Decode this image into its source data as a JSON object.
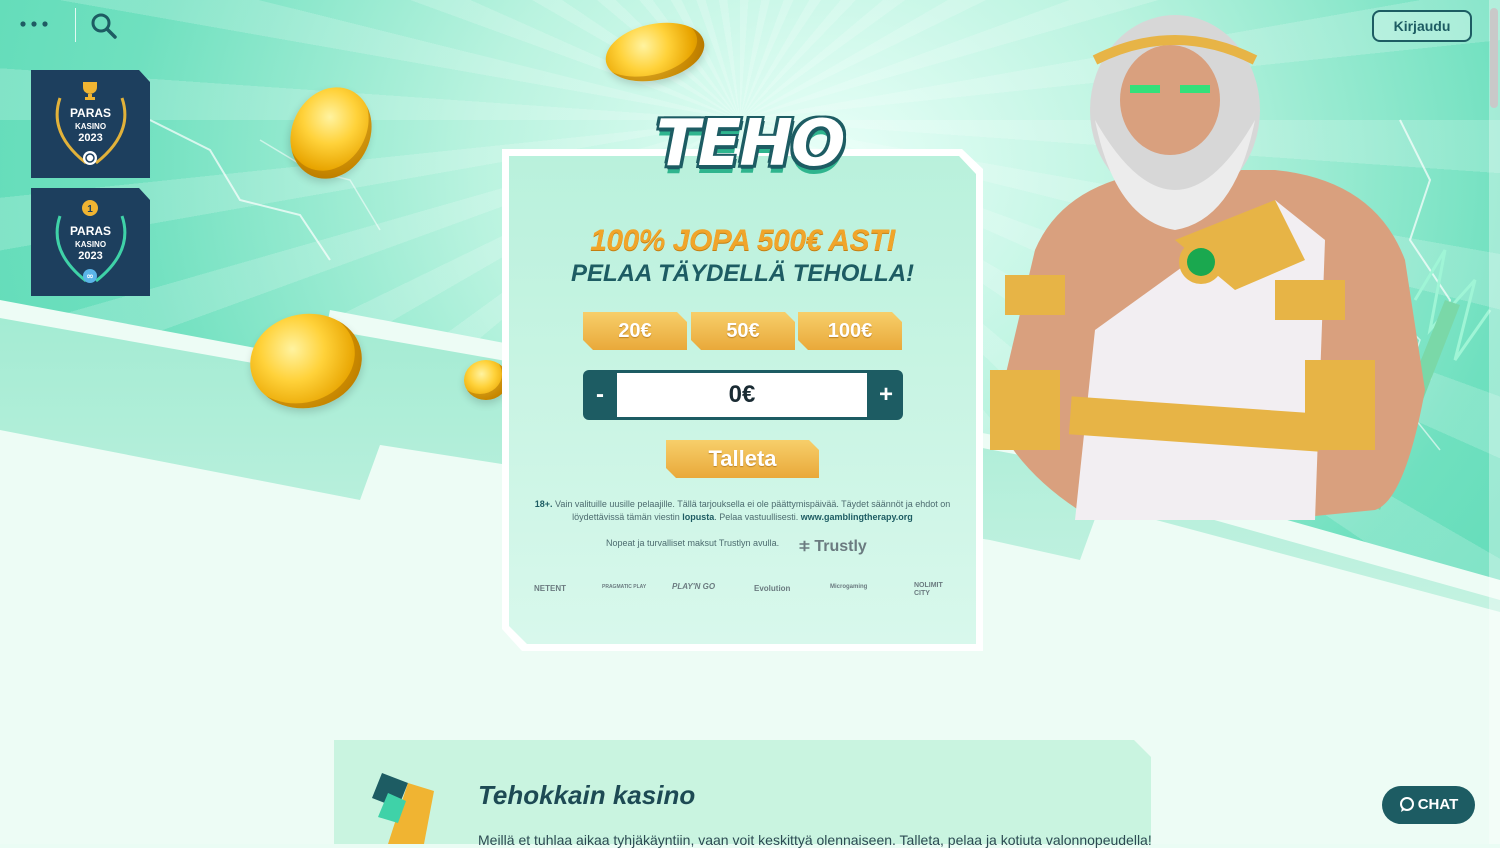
{
  "topbar": {
    "menu_icon": "more-dots-icon",
    "search_icon": "search-icon",
    "login_label": "Kirjaudu"
  },
  "badges": [
    {
      "line1": "PARAS",
      "line2": "KASINO",
      "line3": "2023",
      "icon": "trophy-icon"
    },
    {
      "line1": "PARAS",
      "line2": "KASINO",
      "line3": "2023",
      "icon": "medal-icon"
    }
  ],
  "logo": {
    "text": "TEHO"
  },
  "offer": {
    "headline": "100% JOPA 500€ ASTI",
    "subline": "PELAA TÄYDELLÄ TEHOLLA!",
    "amounts": [
      "20€",
      "50€",
      "100€"
    ],
    "stepper": {
      "minus": "-",
      "plus": "+",
      "value": "0€"
    },
    "deposit_label": "Talleta"
  },
  "terms": {
    "age": "18+.",
    "text_a": " Vain valituille uusille pelaajille. Tällä tarjouksella ei ole päättymispäivää. Täydet säännöt ja ehdot on löydettävissä tämän viestin ",
    "link": "lopusta",
    "text_b": ". Pelaa vastuullisesti. ",
    "site": "www.gamblingtherapy.org"
  },
  "trustly": {
    "text": "Nopeat ja turvalliset maksut Trustlyn avulla.",
    "logo": "Trustly"
  },
  "providers": [
    "NETENT",
    "PRAGMATIC PLAY",
    "PLAY'N GO",
    "Evolution",
    "Microgaming",
    "NOLIMIT CITY"
  ],
  "info": {
    "title": "Tehokkain kasino",
    "text": "Meillä et tuhlaa aikaa tyhjäkäyntiin, vaan voit keskittyä olennaiseen. Talleta, pelaa ja kotiuta valonnopeudella!"
  },
  "chat": {
    "label": "CHAT",
    "icon": "chat-bubble-icon"
  },
  "colors": {
    "primary": "#1d5c63",
    "gold": "#f0a52a",
    "mint": "#4fd6b0"
  }
}
